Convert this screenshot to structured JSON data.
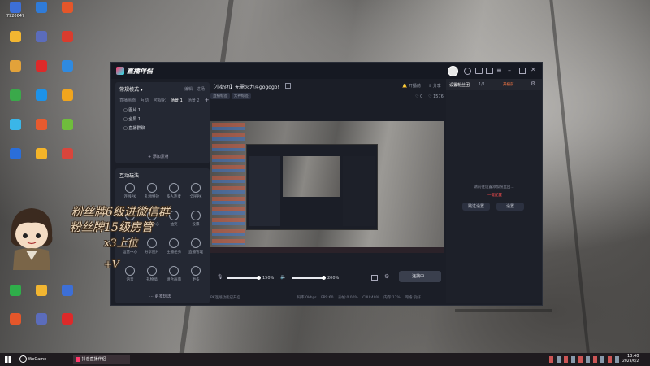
{
  "desktop": {
    "icons": [
      {
        "label": "7920647",
        "color": "#3d6fd6"
      },
      {
        "label": "",
        "color": "#2f7bd8"
      },
      {
        "label": "",
        "color": "#e4562a"
      },
      {
        "label": "",
        "color": "#f2b631"
      },
      {
        "label": "",
        "color": "#5b6cbb"
      },
      {
        "label": "",
        "color": "#d83c2e"
      },
      {
        "label": "",
        "color": "#e2a23a"
      },
      {
        "label": "",
        "color": "#dd2a2a"
      },
      {
        "label": "",
        "color": "#2f8ae0"
      },
      {
        "label": "",
        "color": "#3aa94a"
      },
      {
        "label": "",
        "color": "#1d92e8"
      },
      {
        "label": "",
        "color": "#f0a51e"
      },
      {
        "label": "",
        "color": "#3ab6e8"
      },
      {
        "label": "",
        "color": "#e75a2f"
      },
      {
        "label": "",
        "color": "#6fbd3c"
      },
      {
        "label": "",
        "color": "#2a6ed9"
      },
      {
        "label": "",
        "color": "#f4b429"
      },
      {
        "label": "",
        "color": "#d9453c"
      }
    ]
  },
  "app": {
    "logo_text": "直播伴侣",
    "stream_title": "【小奶团】无需火力斗gogogo!",
    "tags": [
      "直播标签",
      "大神标签"
    ],
    "header_actions": {
      "start": "开播前",
      "share": "分享"
    },
    "stats": {
      "likes": "0",
      "viewers": "1576"
    },
    "window_controls": [
      "minimize",
      "restore",
      "close"
    ]
  },
  "left_panel": {
    "mode_label": "常规模式",
    "mode_actions": [
      "编辑",
      "进场"
    ],
    "tabs": [
      "直播画面",
      "互动",
      "可视化",
      "场景 1",
      "场景 2"
    ],
    "active_tab": 3,
    "scenes": [
      "图片 1",
      "全屏 1",
      "直播群聊"
    ],
    "add_source": "添加素材",
    "tools_title": "互动玩法",
    "tools_row1": [
      "连线PK",
      "礼物特效",
      "多人连麦",
      "全民PK"
    ],
    "tools_row2": [
      "粉丝团",
      "任务中心",
      "抽奖",
      "投票"
    ],
    "tools_row3": [
      "运营中心",
      "分享图片",
      "主播任务",
      "直播管理"
    ],
    "tools_row4": [
      "语音",
      "礼物墙",
      "组合画面",
      "更多"
    ],
    "more_label": "更多玩法"
  },
  "preview": {
    "mic_percent": "150%",
    "speaker_percent": "200%",
    "connect_button": "连接中..."
  },
  "status_bar": {
    "items": [
      "PK连线功能已开启",
      "码率:0kbps",
      "FPS:60",
      "丢帧:0.00%",
      "CPU:40%",
      "内存:17%",
      "网络:良好"
    ]
  },
  "right_panel": {
    "title": "设置粉丝团",
    "page": "1/1",
    "badge": "开播前",
    "hint": "请前往设置添加粉丝团...",
    "link": "一键配置",
    "buttons": [
      "跳过设置",
      "设置"
    ]
  },
  "overlay_text": {
    "line1": "粉丝牌6级进微信群",
    "line2": "粉丝牌15级房管",
    "line3": "x3上位",
    "line4": "+V"
  },
  "taskbar": {
    "apps": [
      "WeGame",
      "抖音直播伴侣"
    ],
    "time": "13:40",
    "date": "2023/6/2"
  },
  "colors": {
    "accent": "#3f7cff",
    "window_bg": "#1b1e27",
    "panel_bg": "#242833",
    "red_badge": "#ff4d4f"
  }
}
